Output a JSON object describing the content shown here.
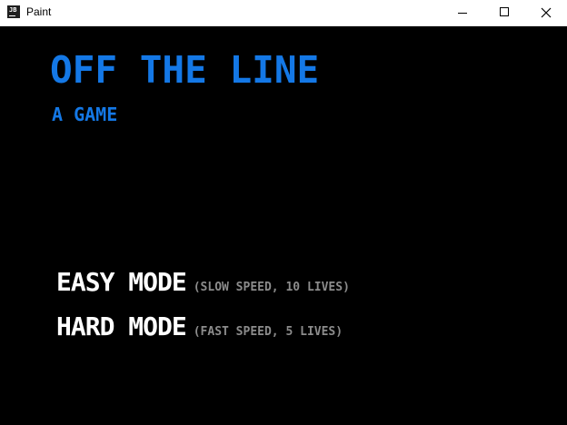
{
  "window": {
    "title": "Paint",
    "icon_text": "JB",
    "icon": "jetbrains-app-icon"
  },
  "controls": {
    "minimize_icon": "minimize-icon",
    "maximize_icon": "maximize-icon",
    "close_icon": "close-icon"
  },
  "game": {
    "title": "OFF THE LINE",
    "subtitle": "A GAME",
    "modes": [
      {
        "label": "EASY MODE",
        "description": "(SLOW SPEED, 10 LIVES)"
      },
      {
        "label": "HARD MODE",
        "description": "(FAST SPEED, 5 LIVES)"
      }
    ]
  },
  "colors": {
    "background": "#000000",
    "accent": "#1478e6",
    "menu_text": "#ffffff",
    "menu_description": "#8c8c8c"
  }
}
